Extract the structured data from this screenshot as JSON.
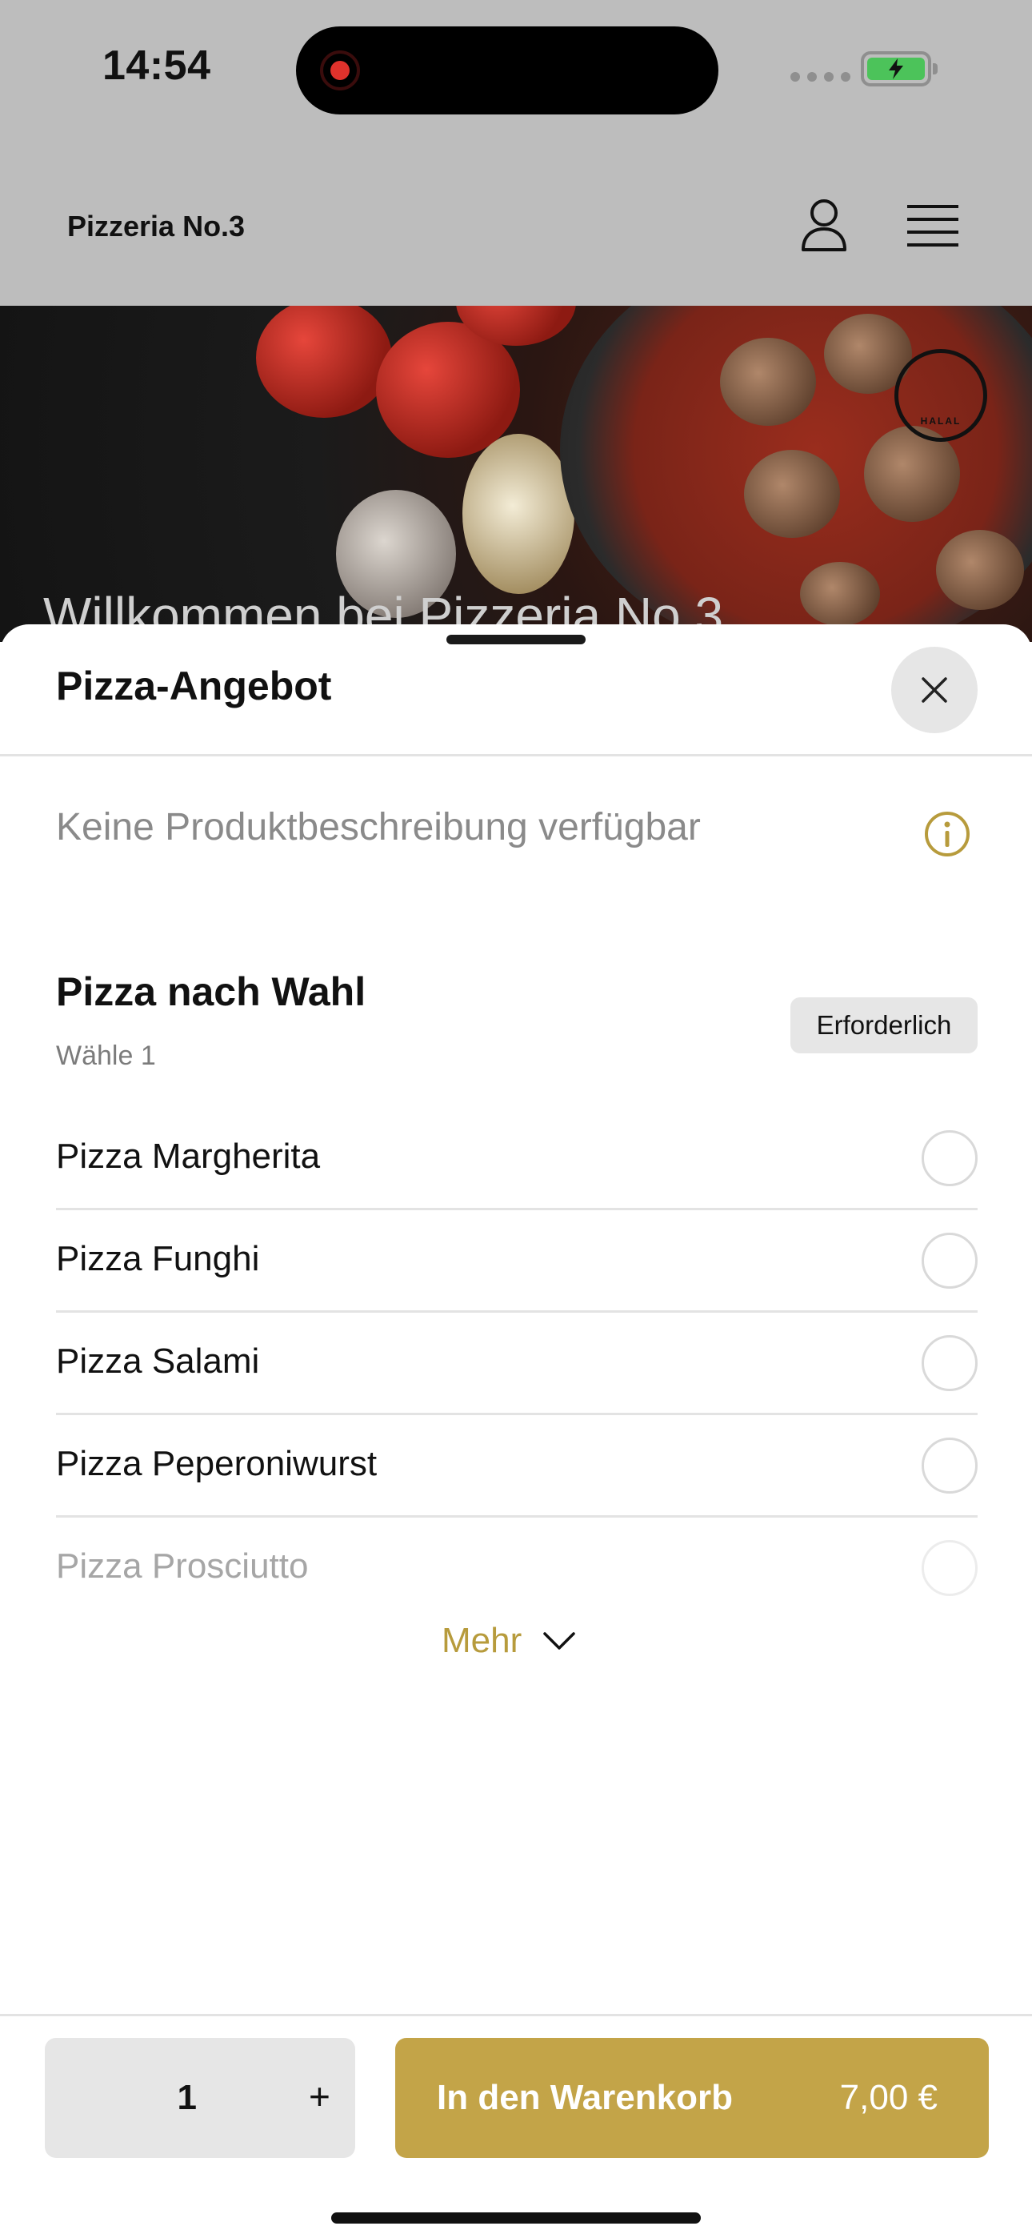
{
  "status_bar": {
    "time": "14:54",
    "recording_indicator_color": "#e0322c",
    "battery_color": "#4cc35a",
    "icons": [
      "recording-icon",
      "signal-icon",
      "battery-charging-icon"
    ]
  },
  "app_bar": {
    "brand": "Pizzeria No.3",
    "icons": [
      "user-icon",
      "menu-icon"
    ]
  },
  "hero": {
    "welcome_text": "Willkommen bei Pizzeria No.3",
    "badge_icon": "halal-badge-icon"
  },
  "sheet": {
    "title": "Pizza-Angebot",
    "close_icon": "close-icon",
    "description": "Keine Produktbeschreibung verfügbar",
    "info_icon": "info-icon",
    "group": {
      "title": "Pizza nach Wahl",
      "subtitle": "Wähle 1",
      "badge": "Erforderlich",
      "options": [
        {
          "label": "Pizza Margherita"
        },
        {
          "label": "Pizza Funghi"
        },
        {
          "label": "Pizza Salami"
        },
        {
          "label": "Pizza Peperoniwurst"
        },
        {
          "label": "Pizza Prosciutto"
        }
      ]
    },
    "more_label": "Mehr"
  },
  "footer": {
    "quantity": "1",
    "plus_label": "+",
    "cart_label": "In den Warenkorb",
    "price": "7,00 €"
  },
  "colors": {
    "accent": "#c3a448",
    "accent_text": "#b79b3c",
    "overlay_gray": "#bdbdbd"
  }
}
